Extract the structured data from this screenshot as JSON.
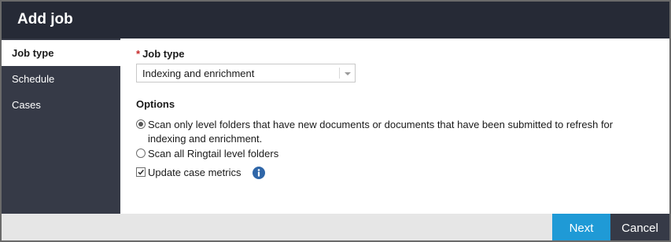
{
  "dialog": {
    "title": "Add job"
  },
  "sidebar": {
    "items": [
      {
        "label": "Job type",
        "active": true
      },
      {
        "label": "Schedule",
        "active": false
      },
      {
        "label": "Cases",
        "active": false
      }
    ]
  },
  "job_type": {
    "required_marker": "*",
    "label": "Job type",
    "selected_value": "Indexing and enrichment"
  },
  "options": {
    "heading": "Options",
    "radio_1": {
      "line_1": "Scan only level folders that have new documents or documents that have been submitted to refresh for",
      "line_2": "indexing and enrichment.",
      "checked": true
    },
    "radio_2": {
      "label": "Scan all Ringtail level folders",
      "checked": false
    },
    "checkbox": {
      "label": "Update case metrics",
      "checked": true
    },
    "info_icon": "info-icon"
  },
  "footer": {
    "next_label": "Next",
    "cancel_label": "Cancel"
  },
  "colors": {
    "header_bg": "#262a36",
    "sidebar_bg": "#363a47",
    "accent": "#1f9ad6",
    "info": "#2f66a8",
    "required": "#c62828"
  }
}
